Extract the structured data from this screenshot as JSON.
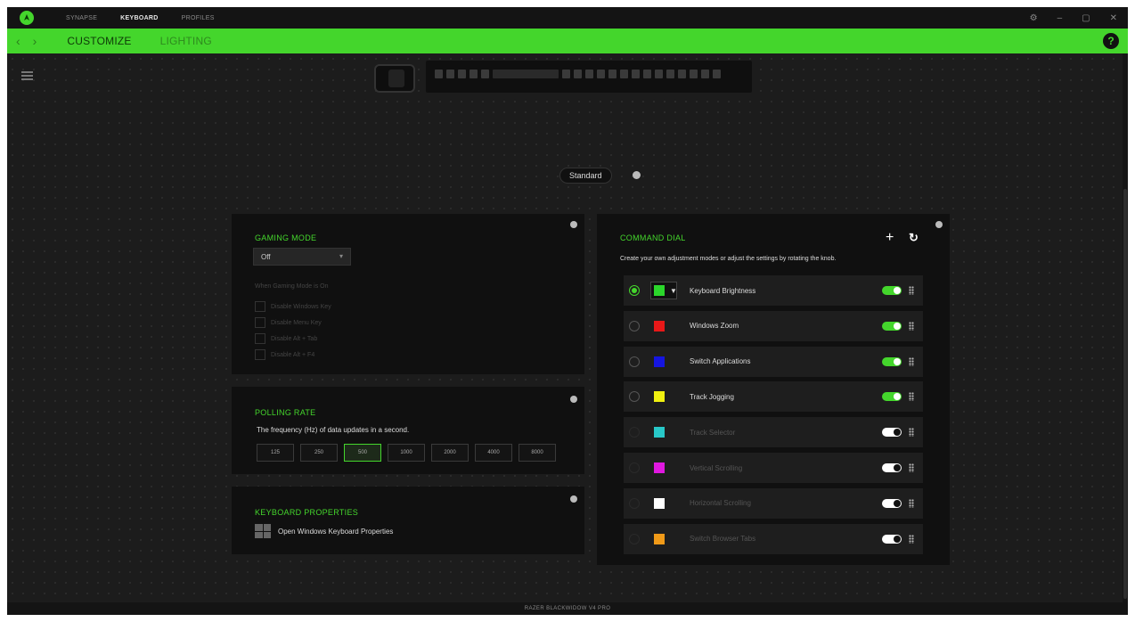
{
  "topnav": [
    "SYNAPSE",
    "KEYBOARD",
    "PROFILES"
  ],
  "window_controls": {
    "settings": "⚙",
    "minimize": "–",
    "maximize": "▢",
    "close": "✕"
  },
  "tabs": {
    "customize": "CUSTOMIZE",
    "lighting": "LIGHTING"
  },
  "help": "?",
  "profile_mode": "Standard",
  "gaming_mode": {
    "title": "GAMING MODE",
    "selected": "Off",
    "when_enabled": "When Gaming Mode is On",
    "options": [
      "Disable Windows Key",
      "Disable Menu Key",
      "Disable Alt + Tab",
      "Disable Alt + F4"
    ]
  },
  "polling_rate": {
    "title": "POLLING RATE",
    "description": "The frequency (Hz) of data updates in a second.",
    "options": [
      "125",
      "250",
      "500",
      "1000",
      "2000",
      "4000",
      "8000"
    ],
    "selected": "500"
  },
  "keyboard_properties": {
    "title": "KEYBOARD PROPERTIES",
    "link": "Open Windows Keyboard Properties"
  },
  "command_dial": {
    "title": "COMMAND DIAL",
    "description": "Create your own adjustment modes or adjust the settings by rotating the knob.",
    "add": "+",
    "reset": "↻",
    "items": [
      {
        "label": "Keyboard Brightness",
        "color": "#2bd62b",
        "enabled": true,
        "selected": true
      },
      {
        "label": "Windows Zoom",
        "color": "#e81818",
        "enabled": true,
        "selected": false
      },
      {
        "label": "Switch Applications",
        "color": "#1515e0",
        "enabled": true,
        "selected": false
      },
      {
        "label": "Track Jogging",
        "color": "#f0f010",
        "enabled": true,
        "selected": false
      },
      {
        "label": "Track Selector",
        "color": "#28c8c8",
        "enabled": false,
        "selected": false
      },
      {
        "label": "Vertical Scrolling",
        "color": "#e018e0",
        "enabled": false,
        "selected": false
      },
      {
        "label": "Horizontal Scrolling",
        "color": "#ffffff",
        "enabled": false,
        "selected": false
      },
      {
        "label": "Switch Browser Tabs",
        "color": "#f09a18",
        "enabled": false,
        "selected": false
      }
    ]
  },
  "device_name": "RAZER BLACKWIDOW V4 PRO",
  "colors": {
    "accent": "#44d62c",
    "background": "#1c1c1c",
    "panel": "#101010"
  }
}
